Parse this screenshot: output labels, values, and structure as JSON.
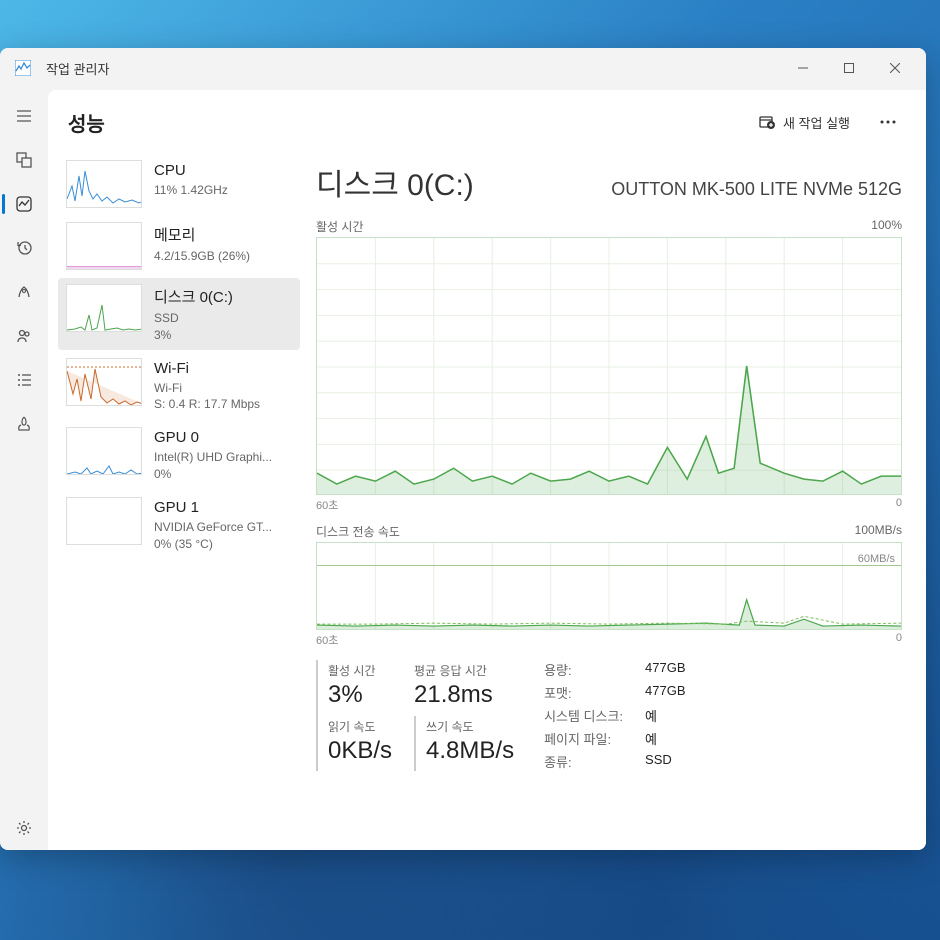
{
  "app": {
    "title": "작업 관리자"
  },
  "header": {
    "title": "성능",
    "new_task": "새 작업 실행"
  },
  "sidebar": {
    "items": [
      {
        "name": "CPU",
        "sub1": "11% 1.42GHz",
        "sub2": ""
      },
      {
        "name": "메모리",
        "sub1": "4.2/15.9GB (26%)",
        "sub2": ""
      },
      {
        "name": "디스크 0(C:)",
        "sub1": "SSD",
        "sub2": "3%"
      },
      {
        "name": "Wi-Fi",
        "sub1": "Wi-Fi",
        "sub2": "S: 0.4 R: 17.7 Mbps"
      },
      {
        "name": "GPU 0",
        "sub1": "Intel(R) UHD Graphi...",
        "sub2": "0%"
      },
      {
        "name": "GPU 1",
        "sub1": "NVIDIA GeForce GT...",
        "sub2": "0% (35 °C)"
      }
    ]
  },
  "detail": {
    "title": "디스크 0(C:)",
    "model": "OUTTON MK-500 LITE NVMe 512G",
    "chart1": {
      "label": "활성 시간",
      "max": "100%",
      "time_left": "60초",
      "time_right": "0"
    },
    "chart2": {
      "label": "디스크 전송 속도",
      "max": "100MB/s",
      "mid": "60MB/s",
      "time_left": "60초",
      "time_right": "0"
    },
    "stats": {
      "active_time_label": "활성 시간",
      "active_time_value": "3%",
      "avg_response_label": "평균 응답 시간",
      "avg_response_value": "21.8ms",
      "read_speed_label": "읽기 속도",
      "read_speed_value": "0KB/s",
      "write_speed_label": "쓰기 속도",
      "write_speed_value": "4.8MB/s"
    },
    "props": {
      "capacity_label": "용량:",
      "capacity_value": "477GB",
      "format_label": "포맷:",
      "format_value": "477GB",
      "system_disk_label": "시스템 디스크:",
      "system_disk_value": "예",
      "page_file_label": "페이지 파일:",
      "page_file_value": "예",
      "type_label": "종류:",
      "type_value": "SSD"
    }
  },
  "chart_data": {
    "type": "line",
    "title": "디스크 0(C:) 활성 시간 & 전송 속도",
    "series": [
      {
        "name": "활성 시간 (%)",
        "ylim": [
          0,
          100
        ],
        "x_seconds_ago": [
          60,
          58,
          56,
          54,
          52,
          50,
          48,
          46,
          44,
          42,
          40,
          38,
          36,
          34,
          32,
          30,
          28,
          26,
          24,
          22,
          20,
          18,
          16,
          14,
          12,
          10,
          8,
          6,
          4,
          2,
          0
        ],
        "values": [
          8,
          4,
          7,
          5,
          9,
          4,
          6,
          10,
          5,
          7,
          4,
          8,
          5,
          6,
          9,
          5,
          7,
          4,
          18,
          6,
          22,
          8,
          10,
          50,
          12,
          8,
          6,
          5,
          9,
          4,
          7
        ]
      },
      {
        "name": "읽기 속도 (MB/s)",
        "ylim": [
          0,
          100
        ],
        "x_seconds_ago": [
          60,
          58,
          56,
          54,
          52,
          50,
          48,
          46,
          44,
          42,
          40,
          38,
          36,
          34,
          32,
          30,
          28,
          26,
          24,
          22,
          20,
          18,
          16,
          14,
          12,
          10,
          8,
          6,
          4,
          2,
          0
        ],
        "values": [
          2,
          1,
          2,
          1,
          3,
          1,
          2,
          3,
          1,
          2,
          1,
          2,
          1,
          2,
          3,
          1,
          2,
          1,
          5,
          2,
          6,
          2,
          3,
          30,
          3,
          2,
          1,
          1,
          2,
          1,
          2
        ]
      },
      {
        "name": "쓰기 속도 (MB/s)",
        "ylim": [
          0,
          100
        ],
        "x_seconds_ago": [
          60,
          58,
          56,
          54,
          52,
          50,
          48,
          46,
          44,
          42,
          40,
          38,
          36,
          34,
          32,
          30,
          28,
          26,
          24,
          22,
          20,
          18,
          16,
          14,
          12,
          10,
          8,
          6,
          4,
          2,
          0
        ],
        "values": [
          3,
          2,
          3,
          2,
          4,
          2,
          3,
          4,
          2,
          3,
          2,
          3,
          2,
          3,
          4,
          2,
          3,
          2,
          4,
          3,
          5,
          3,
          4,
          6,
          4,
          12,
          3,
          2,
          4,
          2,
          5
        ]
      }
    ]
  }
}
